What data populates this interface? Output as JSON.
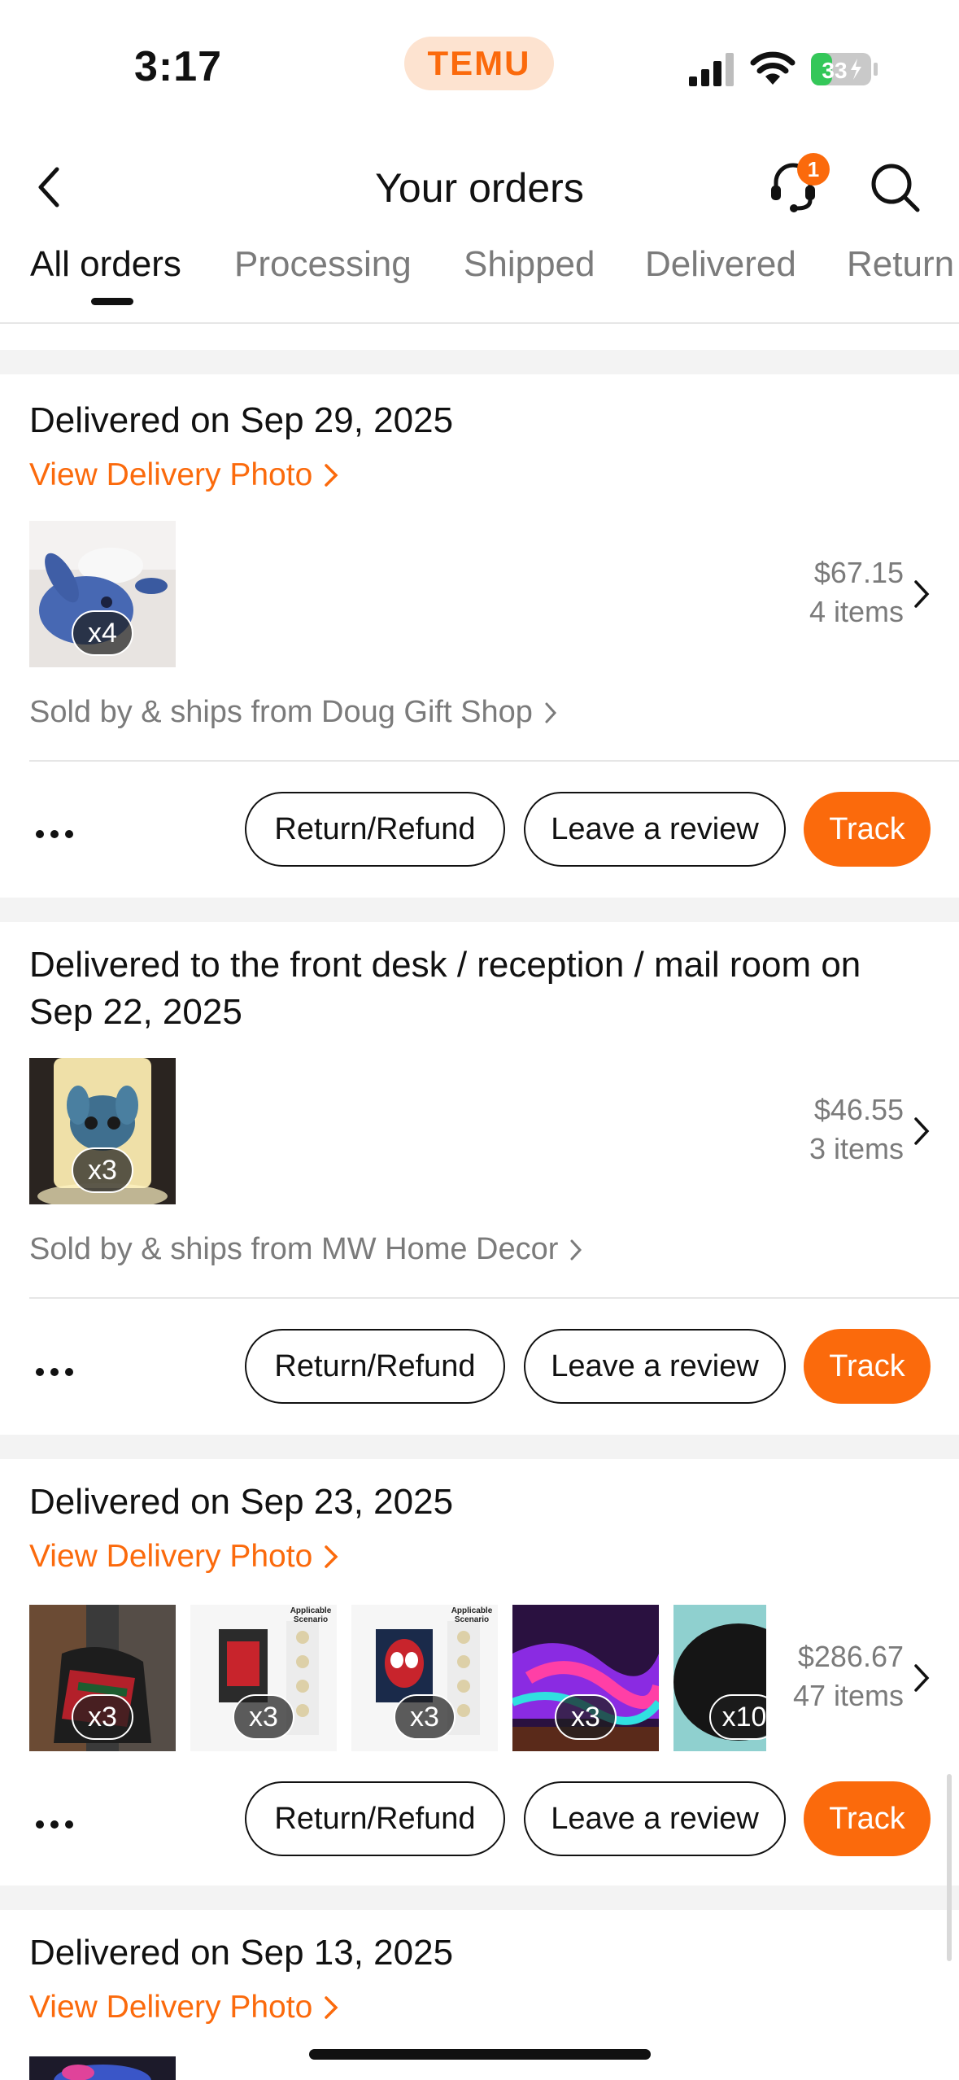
{
  "status_bar": {
    "time": "3:17",
    "app_pill": "TEMU",
    "battery": "33"
  },
  "header": {
    "title": "Your orders",
    "support_badge": "1"
  },
  "tabs": [
    {
      "label": "All orders",
      "active": true
    },
    {
      "label": "Processing",
      "active": false
    },
    {
      "label": "Shipped",
      "active": false
    },
    {
      "label": "Delivered",
      "active": false
    },
    {
      "label": "Return",
      "active": false
    }
  ],
  "orders": [
    {
      "title": "Delivered on Sep 29, 2025",
      "delivery_photo_link": "View Delivery Photo",
      "thumbnails": [
        {
          "qty": "x4",
          "icon": "stitch-plush"
        }
      ],
      "price": "$67.15",
      "items": "4 items",
      "seller": "Sold by & ships from Doug Gift Shop",
      "actions": {
        "return": "Return/Refund",
        "review": "Leave a review",
        "track": "Track"
      }
    },
    {
      "title_line1": "Delivered to the front desk / reception / mail room on",
      "title_line2": "Sep 22, 2025",
      "thumbnails": [
        {
          "qty": "x3",
          "icon": "stitch-lamp"
        }
      ],
      "price": "$46.55",
      "items": "3 items",
      "seller": "Sold by & ships from MW Home Decor",
      "actions": {
        "return": "Return/Refund",
        "review": "Leave a review",
        "track": "Track"
      }
    },
    {
      "title": "Delivered on Sep 23, 2025",
      "delivery_photo_link": "View Delivery Photo",
      "thumbnails": [
        {
          "qty": "x3",
          "icon": "blanket-chair"
        },
        {
          "qty": "x3",
          "icon": "spiderman-poster",
          "caption": "Applicable Scenario"
        },
        {
          "qty": "x3",
          "icon": "spiderman-mask-poster",
          "caption": "Applicable Scenario"
        },
        {
          "qty": "x3",
          "icon": "galaxy-bedding"
        },
        {
          "qty": "x10",
          "icon": "black-pillow"
        }
      ],
      "price": "$286.67",
      "items": "47 items",
      "actions": {
        "return": "Return/Refund",
        "review": "Leave a review",
        "track": "Track"
      }
    },
    {
      "title": "Delivered on Sep 13, 2025",
      "delivery_photo_link": "View Delivery Photo"
    }
  ],
  "colors": {
    "accent": "#fb6a0c",
    "muted_text": "#7b7b7b",
    "gap": "#f3f3f3"
  }
}
